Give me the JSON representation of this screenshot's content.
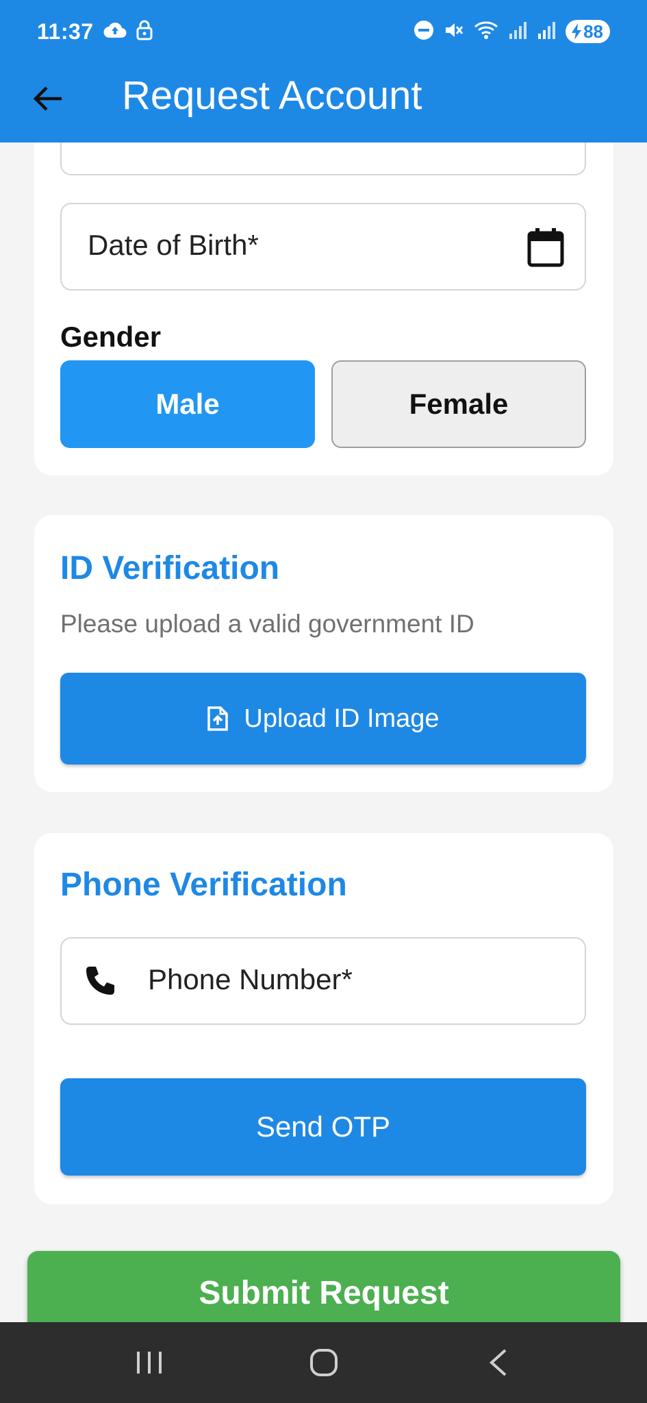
{
  "status_bar": {
    "time": "11:37",
    "battery": "88",
    "icons": [
      "cloud-upload-icon",
      "lock-icon",
      "do-not-disturb-icon",
      "mute-icon",
      "wifi-icon",
      "signal-icon",
      "signal-icon",
      "battery-charging-icon"
    ]
  },
  "app_bar": {
    "title": "Request Account",
    "back_icon": "arrow-back-icon",
    "color": "#1e88e5"
  },
  "personal": {
    "dob_label": "Date of Birth*",
    "dob_icon": "calendar-icon",
    "gender_title": "Gender",
    "gender_options": [
      "Male",
      "Female"
    ],
    "gender_selected": "Male"
  },
  "id_verification": {
    "title": "ID Verification",
    "subtitle": "Please upload a valid government ID",
    "upload_label": "Upload ID Image",
    "upload_icon": "file-upload-icon"
  },
  "phone_verification": {
    "title": "Phone Verification",
    "phone_label": "Phone Number*",
    "phone_icon": "phone-icon",
    "send_otp_label": "Send OTP"
  },
  "submit": {
    "label": "Submit Request",
    "color": "#4caf50"
  },
  "nav_bar": {
    "items": [
      "recent-apps-icon",
      "home-icon",
      "back-icon"
    ]
  }
}
